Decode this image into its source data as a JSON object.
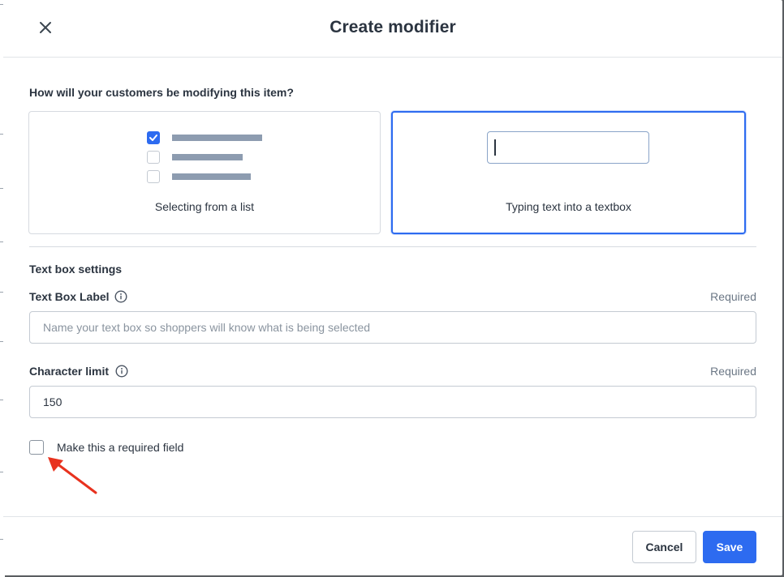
{
  "modal": {
    "title": "Create modifier"
  },
  "question": "How will your customers be modifying this item?",
  "options": [
    {
      "label": "Selecting from a list",
      "selected": false
    },
    {
      "label": "Typing text into a textbox",
      "selected": true
    }
  ],
  "settings": {
    "section_title": "Text box settings",
    "label_field": {
      "label": "Text Box Label",
      "required_text": "Required",
      "placeholder": "Name your text box so shoppers will know what is being selected",
      "value": ""
    },
    "limit_field": {
      "label": "Character limit",
      "required_text": "Required",
      "value": "150"
    },
    "required_checkbox": {
      "label": "Make this a required field",
      "checked": false
    }
  },
  "footer": {
    "cancel_label": "Cancel",
    "save_label": "Save"
  },
  "colors": {
    "accent": "#2d6bf0",
    "annotation_arrow": "#e8321e"
  },
  "icons": {
    "close": "close-icon",
    "info": "info-icon",
    "check": "checkmark-icon"
  }
}
